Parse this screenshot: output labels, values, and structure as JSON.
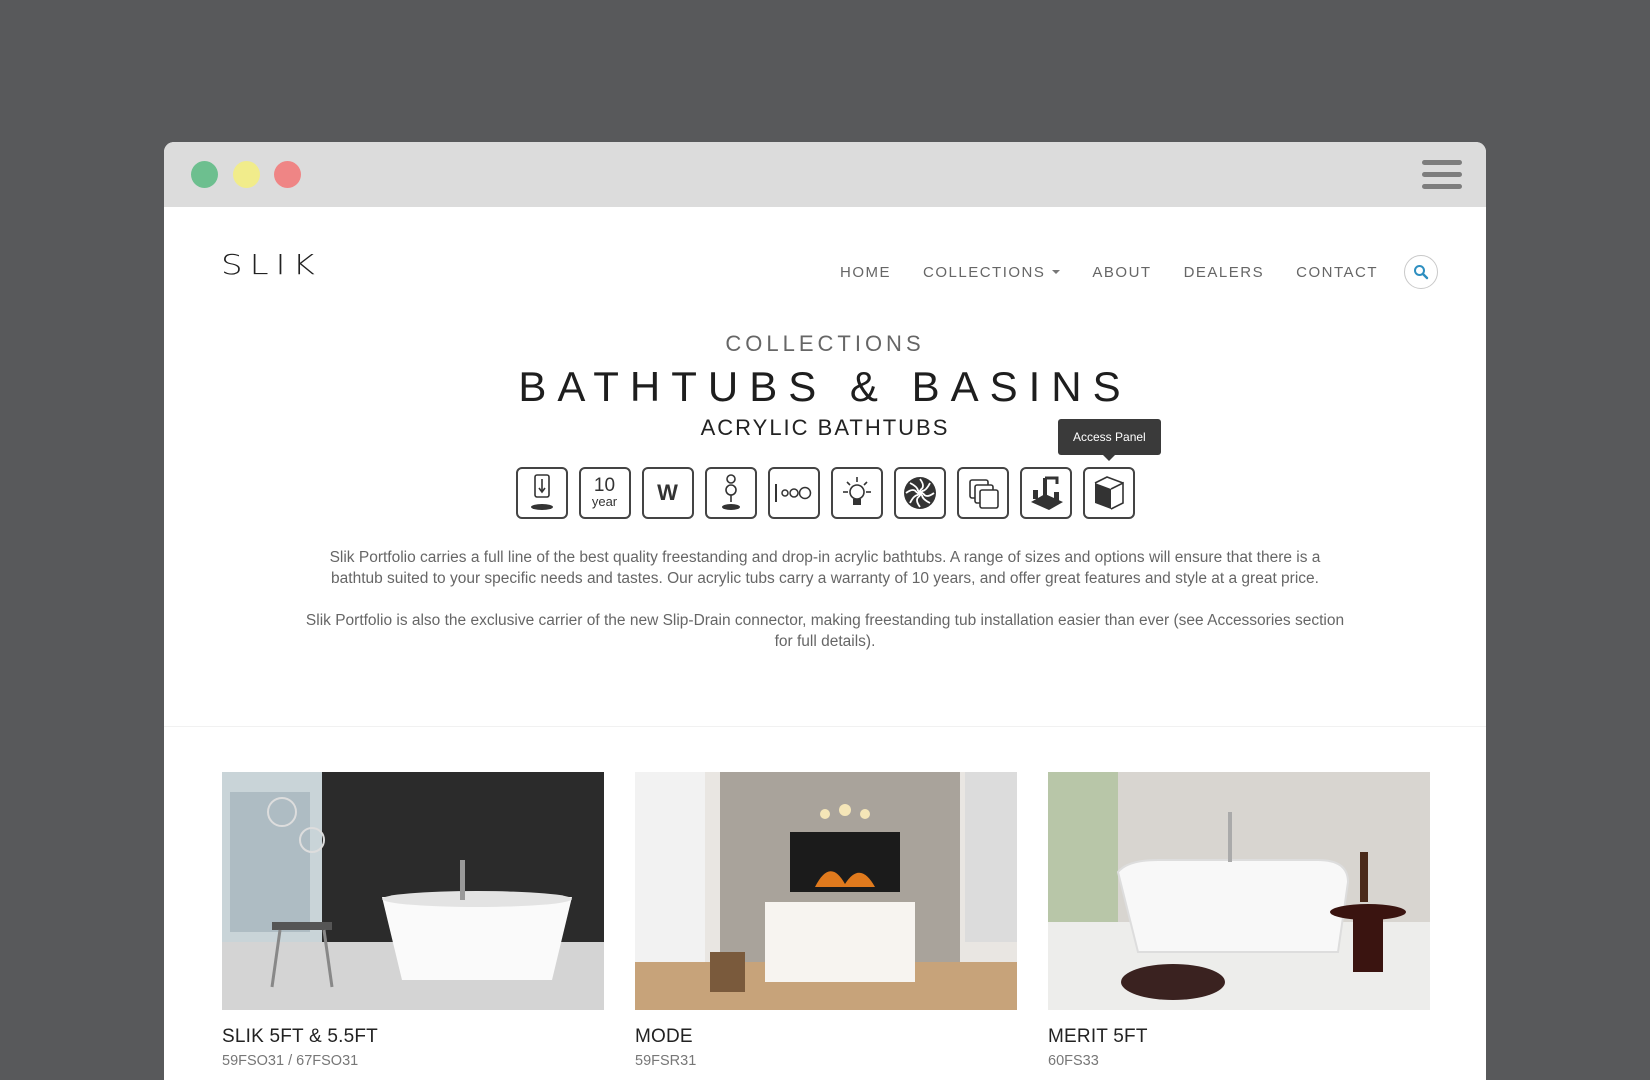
{
  "brand": {
    "logo": "SLIK"
  },
  "nav": {
    "items": [
      "HOME",
      "COLLECTIONS",
      "ABOUT",
      "DEALERS",
      "CONTACT"
    ]
  },
  "hero": {
    "eyebrow": "COLLECTIONS",
    "title": "BATHTUBS & BASINS",
    "subtitle": "ACRYLIC BATHTUBS"
  },
  "features": {
    "icons": [
      "slip-drain-icon",
      "warranty-icon",
      "w-icon",
      "pop-up-drain-icon",
      "overflow-icon",
      "chromatherapy-icon",
      "whirlpool-icon",
      "size-options-icon",
      "faucet-deck-icon",
      "access-panel-icon"
    ],
    "warranty_number": "10",
    "warranty_unit": "year",
    "w_label": "W",
    "tooltip": "Access Panel"
  },
  "description": {
    "p1": "Slik Portfolio carries a full line of the best quality freestanding and drop-in acrylic bathtubs. A range of sizes and options will ensure that there is a bathtub suited to your specific needs and tastes. Our acrylic tubs carry a warranty of 10 years, and offer great features and style at a great price.",
    "p2": "Slik Portfolio is also the exclusive carrier of the new Slip-Drain connector, making freestanding tub installation easier than ever (see Accessories section for full details)."
  },
  "products": [
    {
      "name": "SLIK 5FT & 5.5FT",
      "code": "59FSO31 / 67FSO31"
    },
    {
      "name": "MODE",
      "code": "59FSR31"
    },
    {
      "name": "MERIT 5FT",
      "code": "60FS33"
    }
  ],
  "colors": {
    "background": "#58595b",
    "titlebar": "#dcdcdc",
    "dot_green": "#6dbf8f",
    "dot_yellow": "#f1ec8b",
    "dot_red": "#ef8585",
    "search_accent": "#2e8fc0"
  }
}
